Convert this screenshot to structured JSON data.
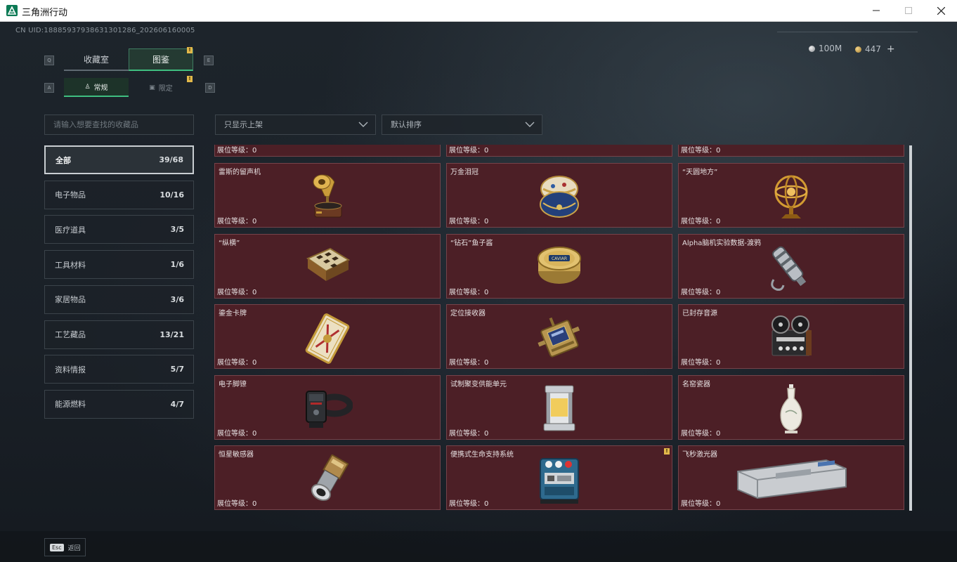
{
  "window": {
    "title": "三角洲行动",
    "minimize": "—",
    "maximize": "☐",
    "close": "✕"
  },
  "header": {
    "uid": "CN UID:188859379386313012​86_202606160005",
    "currency": [
      {
        "name": "silver",
        "value": "100M"
      },
      {
        "name": "gold",
        "value": "447"
      }
    ],
    "plus": "+"
  },
  "tabs": {
    "left_key": "Q",
    "right_key": "E",
    "items": [
      {
        "label": "收藏室",
        "active": false
      },
      {
        "label": "图鉴",
        "active": true,
        "badge": "!"
      }
    ]
  },
  "subtabs": {
    "left_key": "A",
    "right_key": "D",
    "items": [
      {
        "label": "常规",
        "active": true
      },
      {
        "label": "限定",
        "active": false,
        "badge": "!"
      }
    ]
  },
  "search": {
    "placeholder": "请输入想要查找的收藏品"
  },
  "filters": [
    {
      "value": "只显示上架"
    },
    {
      "value": "默认排序"
    }
  ],
  "categories": [
    {
      "label": "全部",
      "count": "39/68",
      "active": true
    },
    {
      "label": "电子物品",
      "count": "10/16"
    },
    {
      "label": "医疗道具",
      "count": "3/5"
    },
    {
      "label": "工具材料",
      "count": "1/6"
    },
    {
      "label": "家居物品",
      "count": "3/6"
    },
    {
      "label": "工艺藏品",
      "count": "13/21"
    },
    {
      "label": "资料情报",
      "count": "5/7"
    },
    {
      "label": "能源燃料",
      "count": "4/7"
    }
  ],
  "level_prefix": "展位等级：",
  "items": [
    {
      "name": "",
      "level": "0",
      "icon": "partial-item-icon"
    },
    {
      "name": "",
      "level": "0",
      "icon": "partial-item-icon"
    },
    {
      "name": "",
      "level": "0",
      "icon": "partial-item-icon"
    },
    {
      "name": "雷斯的留声机",
      "level": "0",
      "icon": "gramophone-icon"
    },
    {
      "name": "万金泪冠",
      "level": "0",
      "icon": "jeweled-egg-icon"
    },
    {
      "name": "“天圆地方”",
      "level": "0",
      "icon": "armillary-sphere-icon"
    },
    {
      "name": "“纵横”",
      "level": "0",
      "icon": "chessboard-icon"
    },
    {
      "name": "“钻石”鱼子酱",
      "level": "0",
      "icon": "caviar-tin-icon"
    },
    {
      "name": "Alpha脑机实验数据-渡鸦",
      "level": "0",
      "icon": "data-canister-icon"
    },
    {
      "name": "鎏金卡牌",
      "level": "0",
      "icon": "gilded-card-icon"
    },
    {
      "name": "定位接收器",
      "level": "0",
      "icon": "locator-receiver-icon"
    },
    {
      "name": "已封存音源",
      "level": "0",
      "icon": "reel-recorder-icon"
    },
    {
      "name": "电子脚镣",
      "level": "0",
      "icon": "ankle-monitor-icon"
    },
    {
      "name": "试制聚变供能单元",
      "level": "0",
      "icon": "fusion-cell-icon"
    },
    {
      "name": "名窑瓷器",
      "level": "0",
      "icon": "porcelain-vase-icon"
    },
    {
      "name": "恒星敏感器",
      "level": "0",
      "icon": "star-sensor-icon"
    },
    {
      "name": "便携式生命支持系统",
      "level": "0",
      "icon": "life-support-icon",
      "badge": "!"
    },
    {
      "name": "飞秒激光器",
      "level": "0",
      "icon": "femtosecond-laser-icon"
    }
  ],
  "footer": {
    "esc_key": "Esc",
    "back_label": "返回"
  },
  "colors": {
    "card_bg": "#4c1f26",
    "card_border": "#75434a",
    "accent": "#3fbf80",
    "badge": "#e2b84a"
  }
}
